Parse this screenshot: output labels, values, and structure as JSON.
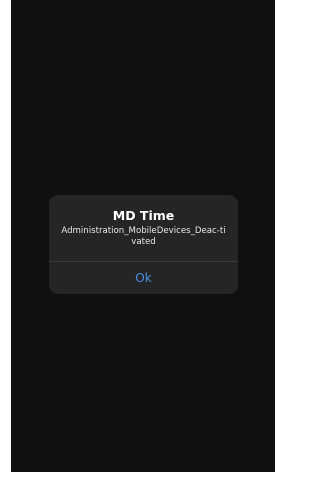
{
  "alert": {
    "title": "MD Time",
    "message": "Administration_MobileDevices_Deac-tivated",
    "button_label": "Ok"
  },
  "colors": {
    "background": "#141414",
    "alert_background": "#252525",
    "button_text": "#4a90e2"
  }
}
